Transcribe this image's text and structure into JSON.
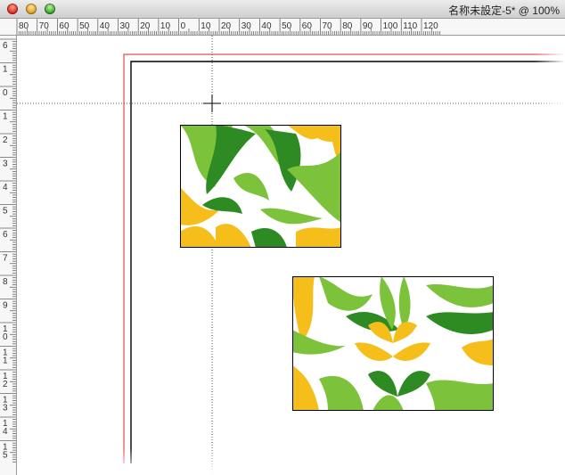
{
  "window": {
    "title": "名称未設定-5* @ 100%"
  },
  "ruler_top_labels": [
    "80",
    "70",
    "60",
    "50",
    "40",
    "30",
    "20",
    "10",
    "0",
    "10",
    "20",
    "30",
    "40",
    "50",
    "60",
    "70",
    "80",
    "90",
    "100",
    "110",
    "120"
  ],
  "ruler_left_labels": [
    "6",
    "1",
    "0",
    "1",
    "2",
    "3",
    "4",
    "5",
    "6",
    "7",
    "8",
    "9",
    "10",
    "11",
    "12",
    "13",
    "14",
    "15"
  ],
  "colors": {
    "margin_guide": "#e02020",
    "page_border": "#000000",
    "leaf_dark": "#2e8a22",
    "leaf_light": "#7cc23a",
    "petal": "#f6be1a"
  },
  "icons": {
    "close": "close-icon",
    "minimize": "minimize-icon",
    "zoom": "zoom-icon",
    "cursor": "crosshair-cursor-icon"
  }
}
